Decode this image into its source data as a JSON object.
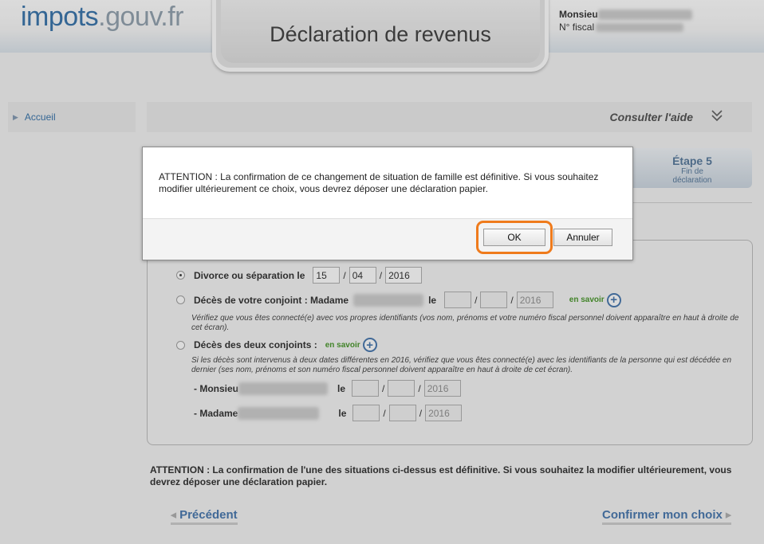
{
  "header": {
    "logo_part1": "impots",
    "logo_part2": ".gouv.fr",
    "page_title": "Déclaration de revenus",
    "user_name_prefix": "Monsieu",
    "fiscal_number_prefix": "N° fiscal"
  },
  "sidebar": {
    "items": [
      {
        "label": "Accueil"
      }
    ]
  },
  "help": {
    "label": "Consulter l'aide"
  },
  "step": {
    "label": "Étape 5",
    "sub1": "Fin de",
    "sub2": "déclaration"
  },
  "form": {
    "divorce": {
      "label": "Divorce ou séparation le",
      "day": "15",
      "month": "04",
      "year": "2016",
      "selected": true
    },
    "deces_conjoint": {
      "label": "Décès de votre conjoint : Madame",
      "le": "le",
      "year": "2016",
      "en_savoir": "en savoir",
      "note": "Vérifiez que vous êtes connecté(e) avec vos propres identifiants (vos nom, prénoms et votre numéro fiscal personnel doivent apparaître en haut à droite de cet écran)."
    },
    "deces_deux": {
      "label": "Décès des deux conjoints :",
      "en_savoir": "en savoir",
      "note": "Si les décès sont intervenus à deux dates différentes en 2016, vérifiez que vous êtes connecté(e) avec les identifiants de la personne qui est décédée en dernier (ses nom, prénoms et son numéro fiscal personnel doivent apparaître en haut à droite de cet écran).",
      "monsieur_label": "- Monsieu",
      "madame_label": "- Madame",
      "le": "le",
      "year1": "2016",
      "year2": "2016"
    }
  },
  "attention_text": "ATTENTION : La confirmation de l'une des situations ci-dessus est définitive. Si vous souhaitez la modifier ultérieurement, vous devrez déposer une déclaration papier.",
  "nav": {
    "previous": "Précédent",
    "confirm": "Confirmer mon choix"
  },
  "dialog": {
    "message": "ATTENTION : La confirmation de ce changement de situation de famille est définitive. Si vous souhaitez modifier ultérieurement ce choix, vous devrez déposer une déclaration papier.",
    "ok_label": "OK",
    "cancel_label": "Annuler"
  },
  "colors": {
    "accent_blue": "#2a6aa5",
    "highlight_orange": "#ef7b1c",
    "link_green": "#3a8f1a"
  }
}
